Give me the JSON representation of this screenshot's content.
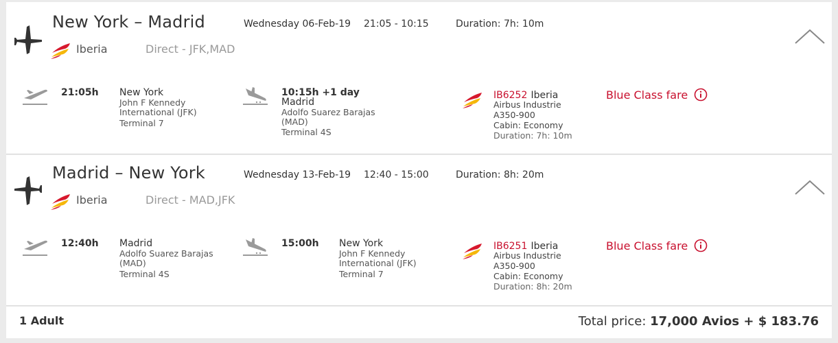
{
  "outbound": {
    "route": "New York – Madrid",
    "date": "Wednesday 06-Feb-19",
    "times": "21:05 - 10:15",
    "duration": "Duration: 7h: 10m",
    "airline": "Iberia",
    "direct": "Direct - JFK,MAD",
    "departure": {
      "time": "21:05h",
      "city": "New York",
      "airport": "John F Kennedy International (JFK)",
      "terminal": "Terminal 7"
    },
    "arrival": {
      "time": "10:15h +1 day",
      "city": "Madrid",
      "airport": "Adolfo Suarez Barajas (MAD)",
      "terminal": "Terminal 4S"
    },
    "flight": {
      "number": "IB6252",
      "airline": "Iberia",
      "aircraft_maker": "Airbus Industrie",
      "aircraft_model": "A350-900",
      "cabin": "Cabin: Economy",
      "duration": "Duration: 7h: 10m"
    },
    "fare": "Blue Class fare"
  },
  "return": {
    "route": "Madrid – New York",
    "date": "Wednesday 13-Feb-19",
    "times": "12:40 - 15:00",
    "duration": "Duration: 8h: 20m",
    "airline": "Iberia",
    "direct": "Direct - MAD,JFK",
    "departure": {
      "time": "12:40h",
      "city": "Madrid",
      "airport": "Adolfo Suarez Barajas (MAD)",
      "terminal": "Terminal 4S"
    },
    "arrival": {
      "time": "15:00h",
      "city": "New York",
      "airport": "John F Kennedy International (JFK)",
      "terminal": "Terminal 7"
    },
    "flight": {
      "number": "IB6251",
      "airline": "Iberia",
      "aircraft_maker": "Airbus Industrie",
      "aircraft_model": "A350-900",
      "cabin": "Cabin: Economy",
      "duration": "Duration: 8h: 20m"
    },
    "fare": "Blue Class fare"
  },
  "footer": {
    "passengers": "1 Adult",
    "total_label": "Total price:",
    "total_value": "17,000 Avios + $ 183.76"
  },
  "icons": {
    "large_plane": "airplane-icon",
    "departure": "takeoff-icon",
    "arrival": "landing-icon",
    "airline_logo": "iberia-logo-icon",
    "collapse": "chevron-up-icon",
    "info": "info-icon"
  },
  "colors": {
    "accent_red": "#c8102e",
    "logo_red": "#d7192d",
    "logo_yellow": "#f5b70b",
    "muted_gray": "#999999"
  }
}
